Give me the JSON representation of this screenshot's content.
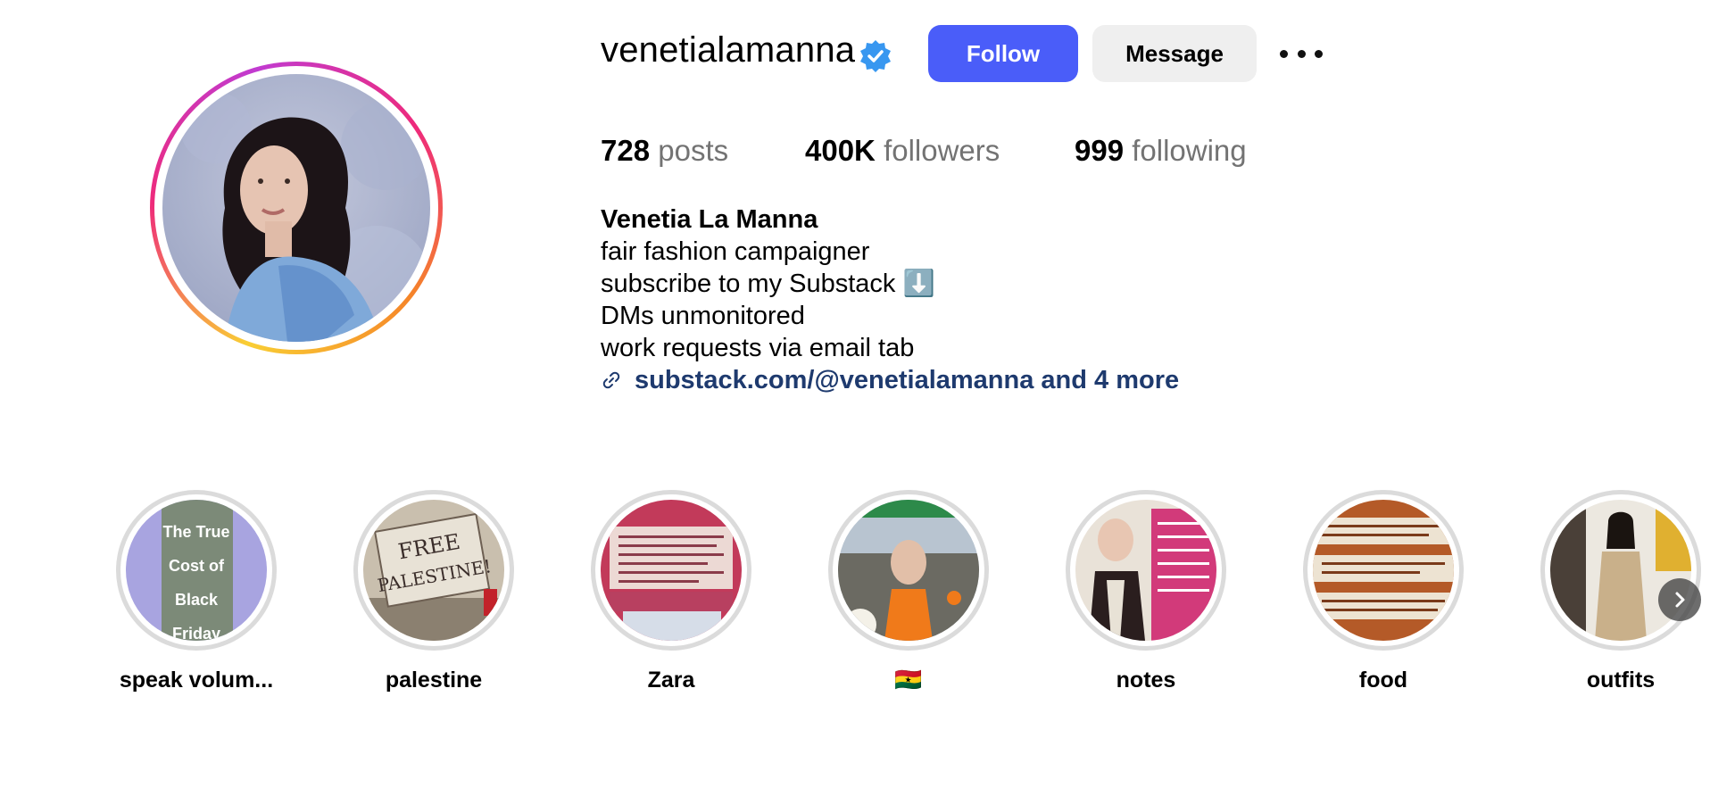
{
  "profile": {
    "username": "venetialamanna",
    "verified_icon": "verified-badge-icon",
    "follow_label": "Follow",
    "message_label": "Message",
    "more_icon": "ellipsis-icon"
  },
  "stats": {
    "posts_count": "728",
    "posts_label": "posts",
    "followers_count": "400K",
    "followers_label": "followers",
    "following_count": "999",
    "following_label": "following"
  },
  "bio": {
    "name": "Venetia La Manna",
    "lines": [
      "fair fashion campaigner",
      "subscribe to my Substack ⬇️",
      "DMs unmonitored",
      "work requests via email tab"
    ],
    "link_icon": "link-icon",
    "link_text": "substack.com/@venetialamanna and 4 more"
  },
  "highlights": [
    {
      "label": "speak volum...",
      "cover_text": [
        "The True",
        "Cost of",
        "Black",
        "Friday"
      ]
    },
    {
      "label": "palestine",
      "cover_text": [
        "FREE",
        "PALESTINE!"
      ]
    },
    {
      "label": "Zara"
    },
    {
      "label": "🇬🇭"
    },
    {
      "label": "notes"
    },
    {
      "label": "food"
    },
    {
      "label": "outfits"
    }
  ],
  "colors": {
    "follow_button": "#4a5df9",
    "message_button": "#efefef",
    "link": "#1e3a6e",
    "secondary_text": "#737373",
    "verified": "#3897f0"
  }
}
